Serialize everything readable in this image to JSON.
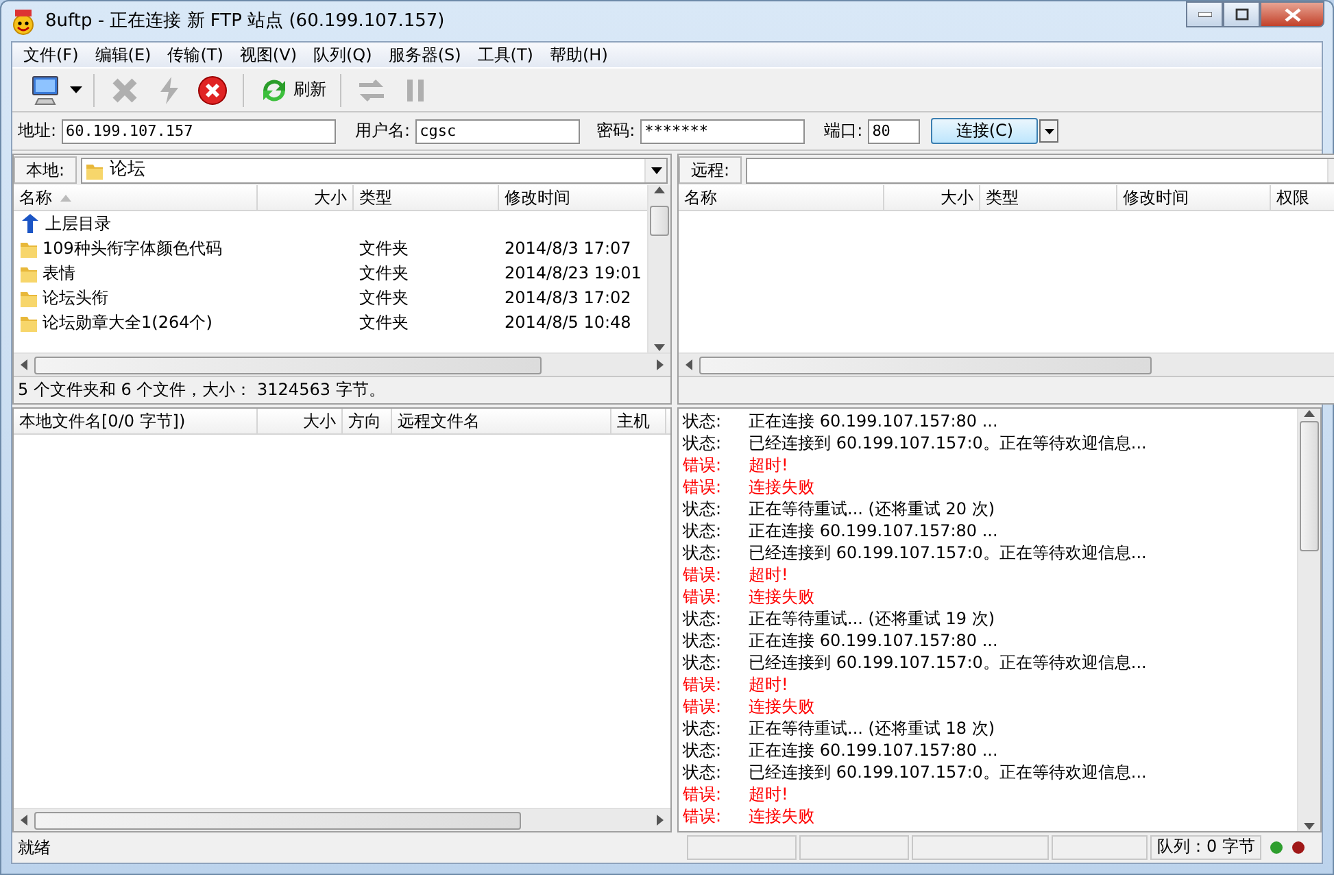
{
  "window": {
    "title": "8uftp - 正在连接 新 FTP 站点 (60.199.107.157)"
  },
  "menu": [
    "文件(F)",
    "编辑(E)",
    "传输(T)",
    "视图(V)",
    "队列(Q)",
    "服务器(S)",
    "工具(T)",
    "帮助(H)"
  ],
  "toolbar": [
    {
      "disabled": false
    },
    {
      "disabled": true
    },
    {
      "disabled": true
    },
    {
      "disabled": false
    },
    {
      "label": "刷新",
      "disabled": false
    },
    {
      "disabled": true
    },
    {
      "disabled": true
    }
  ],
  "quickconnect": {
    "fields": [
      {
        "label": "地址:",
        "value": "60.199.107.157"
      },
      {
        "label": "用户名:",
        "value": "cgsc"
      },
      {
        "label": "密码:",
        "value": "*******"
      },
      {
        "label": "端口:",
        "value": "80"
      }
    ],
    "button": "连接(C)"
  },
  "local": {
    "label": "本地:",
    "path": "论坛",
    "columns": [
      {
        "title": "名称",
        "sorted": true
      },
      {
        "title": "大小",
        "sorted": false
      },
      {
        "title": "类型",
        "sorted": false
      },
      {
        "title": "修改时间",
        "sorted": false
      }
    ],
    "rows": [
      {
        "kind": "parent",
        "name": "上层目录"
      },
      {
        "kind": "folder",
        "name": "109种头衔字体颜色代码",
        "type": "文件夹",
        "modified": "2014/8/3 17:07"
      },
      {
        "kind": "folder",
        "name": "表情",
        "type": "文件夹",
        "modified": "2014/8/23 19:01"
      },
      {
        "kind": "folder",
        "name": "论坛头衔",
        "type": "文件夹",
        "modified": "2014/8/3 17:02"
      },
      {
        "kind": "folder",
        "name": "论坛勋章大全1(264个)",
        "type": "文件夹",
        "modified": "2014/8/5 10:48"
      }
    ],
    "summary": "5 个文件夹和 6 个文件，大小： 3124563 字节。"
  },
  "remote": {
    "label": "远程:",
    "columns": [
      {
        "title": "名称"
      },
      {
        "title": "大小"
      },
      {
        "title": "类型"
      },
      {
        "title": "修改时间"
      },
      {
        "title": "权限"
      }
    ]
  },
  "queue": {
    "columns": [
      "本地文件名[0/0 字节])",
      "大小",
      "方向",
      "远程文件名",
      "主机"
    ]
  },
  "log": [
    {
      "kind": "status",
      "label": "状态:",
      "message": "正在连接 60.199.107.157:80 ..."
    },
    {
      "kind": "status",
      "label": "状态:",
      "message": "已经连接到 60.199.107.157:0。正在等待欢迎信息..."
    },
    {
      "kind": "error",
      "label": "错误:",
      "message": "超时!"
    },
    {
      "kind": "error",
      "label": "错误:",
      "message": "连接失败"
    },
    {
      "kind": "status",
      "label": "状态:",
      "message": "正在等待重试... (还将重试 20 次)"
    },
    {
      "kind": "status",
      "label": "状态:",
      "message": "正在连接 60.199.107.157:80 ..."
    },
    {
      "kind": "status",
      "label": "状态:",
      "message": "已经连接到 60.199.107.157:0。正在等待欢迎信息..."
    },
    {
      "kind": "error",
      "label": "错误:",
      "message": "超时!"
    },
    {
      "kind": "error",
      "label": "错误:",
      "message": "连接失败"
    },
    {
      "kind": "status",
      "label": "状态:",
      "message": "正在等待重试... (还将重试 19 次)"
    },
    {
      "kind": "status",
      "label": "状态:",
      "message": "正在连接 60.199.107.157:80 ..."
    },
    {
      "kind": "status",
      "label": "状态:",
      "message": "已经连接到 60.199.107.157:0。正在等待欢迎信息..."
    },
    {
      "kind": "error",
      "label": "错误:",
      "message": "超时!"
    },
    {
      "kind": "error",
      "label": "错误:",
      "message": "连接失败"
    },
    {
      "kind": "status",
      "label": "状态:",
      "message": "正在等待重试... (还将重试 18 次)"
    },
    {
      "kind": "status",
      "label": "状态:",
      "message": "正在连接 60.199.107.157:80 ..."
    },
    {
      "kind": "status",
      "label": "状态:",
      "message": "已经连接到 60.199.107.157:0。正在等待欢迎信息..."
    },
    {
      "kind": "error",
      "label": "错误:",
      "message": "超时!"
    },
    {
      "kind": "error",
      "label": "错误:",
      "message": "连接失败"
    }
  ],
  "status_bar": {
    "text": "就绪",
    "queue": "队列：0 字节",
    "lights": [
      {
        "color": "#2e9e2e"
      },
      {
        "color": "#a01818"
      }
    ]
  }
}
